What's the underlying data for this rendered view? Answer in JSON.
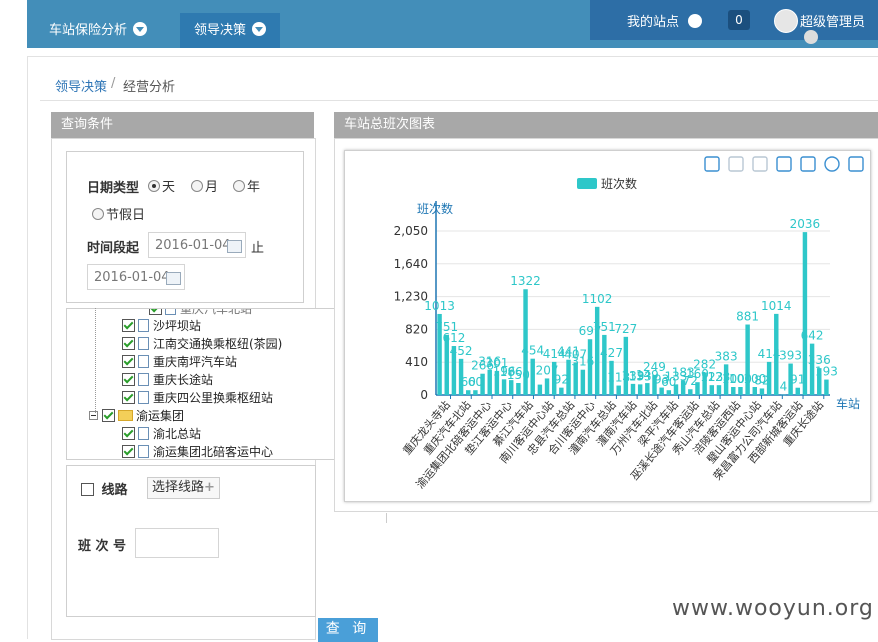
{
  "nav": {
    "items": [
      {
        "label": "车站保险分析"
      },
      {
        "label": "领导决策"
      }
    ],
    "site_label": "我的站点",
    "badge_count": "0",
    "user_label": "超级管理员"
  },
  "breadcrumb": {
    "home": "领导决策",
    "sep": "/",
    "current": "经营分析"
  },
  "query_panel": {
    "title": "查询条件",
    "date_type_label": "日期类型",
    "date_types": [
      "天",
      "月",
      "年",
      "节假日"
    ],
    "selected_date_type": "天",
    "period_label": "时间段起",
    "start_date": "2016-01-04",
    "end_label": "止",
    "end_date": "2016-01-04",
    "tree": {
      "partial_top": "重庆汽车北站",
      "nodes": [
        {
          "label": "沙坪坝站"
        },
        {
          "label": "江南交通换乘枢纽(茶园)"
        },
        {
          "label": "重庆南坪汽车站"
        },
        {
          "label": "重庆长途站"
        },
        {
          "label": "重庆四公里换乘枢纽站"
        }
      ],
      "group": "渝运集团",
      "group_nodes": [
        {
          "label": "渝北总站"
        },
        {
          "label": "渝运集团北碚客运中心"
        }
      ]
    },
    "route_label": "线路",
    "route_button": "选择线路",
    "trip_label": "班 次 号",
    "query_button": "查 询"
  },
  "chart_panel": {
    "title": "车站总班次图表"
  },
  "chart_data": {
    "type": "bar",
    "legend": "班次数",
    "ylabel": "班次数",
    "xlabel": "车站",
    "ylim": [
      0,
      2050
    ],
    "yticks": [
      0,
      410,
      820,
      1230,
      1640,
      2050
    ],
    "y_tick_labels": [
      "0",
      "410",
      "820",
      "1,230",
      "1,640",
      "2,050"
    ],
    "color": "#2ec7c9",
    "x_tick_labels": [
      "重庆龙头寺站",
      "重庆汽车北站",
      "渝运集团北碚客运中心",
      "垫江客运中心",
      "綦江汽车站",
      "南川客运中心站",
      "忠县汽车总站",
      "合川客运中心",
      "潼南汽车总站",
      "潼南汽车站",
      "万州汽车北站",
      "梁平汽车站",
      "巫溪长途汽车客运站",
      "秀山汽车总站",
      "涪陵客运西站",
      "璧山客运中心站",
      "荣昌富力公司汽车站",
      "西部新城客运站",
      "重庆长途站"
    ],
    "values": [
      1013,
      751,
      612,
      452,
      60,
      60,
      266,
      316,
      301,
      196,
      186,
      150,
      1322,
      454,
      130,
      207,
      414,
      92,
      441,
      407,
      316,
      697,
      1102,
      751,
      427,
      118,
      727,
      139,
      133,
      149,
      249,
      93,
      60,
      133,
      183,
      72,
      160,
      282,
      123,
      123,
      383,
      100,
      100,
      881,
      100,
      82,
      414,
      1014,
      4,
      393,
      91,
      2036,
      642,
      336,
      193
    ],
    "labels": [
      "1013",
      "751",
      "612",
      "452",
      "60",
      "60",
      "266",
      "316",
      "301",
      "196",
      "186",
      "150",
      "1322",
      "454",
      "",
      "207",
      "414",
      "92",
      "441",
      "407",
      "316",
      "697",
      "1102",
      "751",
      "427",
      "118",
      "727",
      "139",
      "133",
      "149",
      "249",
      "93",
      "60",
      "133",
      "183",
      "72",
      "160",
      "282",
      "123",
      "123",
      "383",
      "100",
      "100",
      "881",
      "100",
      "82",
      "414",
      "1014",
      "4",
      "393",
      "91",
      "2036",
      "642",
      "336",
      "193"
    ]
  },
  "toolbar_icons": [
    "mark-icon",
    "unmark-icon",
    "clear-icon",
    "line-chart-icon",
    "bar-chart-icon",
    "refresh-icon",
    "save-image-icon"
  ],
  "watermark": "www.wooyun.org"
}
